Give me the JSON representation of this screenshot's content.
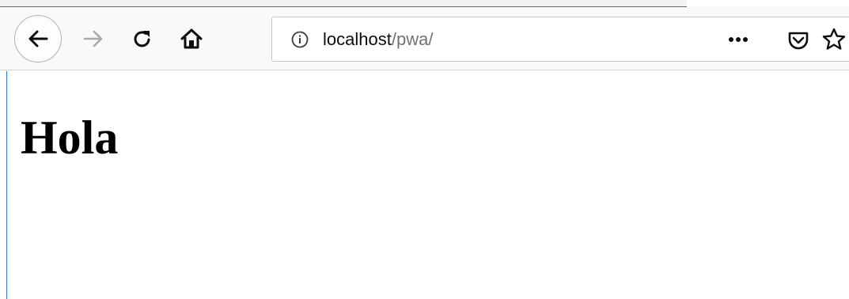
{
  "browser": {
    "url": {
      "host": "localhost",
      "path": "/pwa/"
    },
    "icons": {
      "back": "back-arrow-icon",
      "forward": "forward-arrow-icon",
      "reload": "reload-icon",
      "home": "home-icon",
      "info": "info-icon",
      "page_actions": "more-icon",
      "pocket": "pocket-icon",
      "bookmark": "star-icon"
    },
    "forward_enabled": false
  },
  "page": {
    "heading": "Hola"
  }
}
